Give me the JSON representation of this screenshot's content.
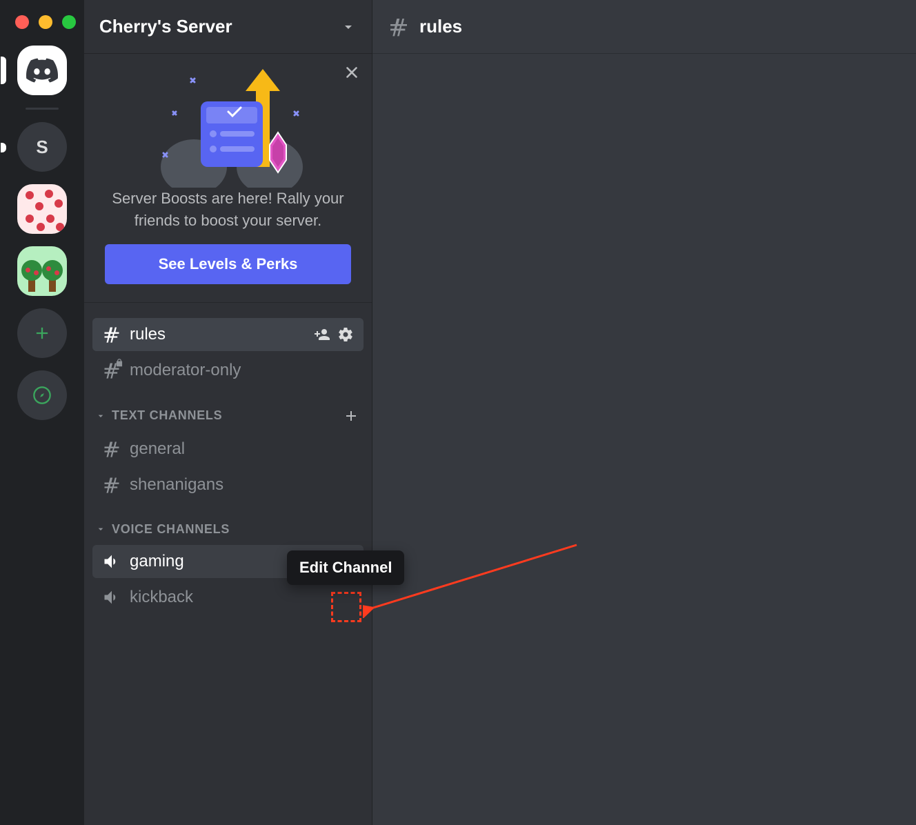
{
  "server": {
    "name": "Cherry's Server"
  },
  "server_rail": {
    "initial": "S"
  },
  "boost_card": {
    "text": "Server Boosts are here! Rally your friends to boost your server.",
    "cta": "See Levels & Perks"
  },
  "top_channels": [
    {
      "name": "rules",
      "selected": true,
      "type": "text",
      "private": false
    },
    {
      "name": "moderator-only",
      "selected": false,
      "type": "text",
      "private": true
    }
  ],
  "categories": [
    {
      "label": "TEXT CHANNELS",
      "channels": [
        {
          "name": "general",
          "type": "text"
        },
        {
          "name": "shenanigans",
          "type": "text"
        }
      ]
    },
    {
      "label": "VOICE CHANNELS",
      "channels": [
        {
          "name": "gaming",
          "type": "voice",
          "hovered": true
        },
        {
          "name": "kickback",
          "type": "voice"
        }
      ]
    }
  ],
  "main": {
    "channel_name": "rules"
  },
  "tooltip": "Edit Channel"
}
